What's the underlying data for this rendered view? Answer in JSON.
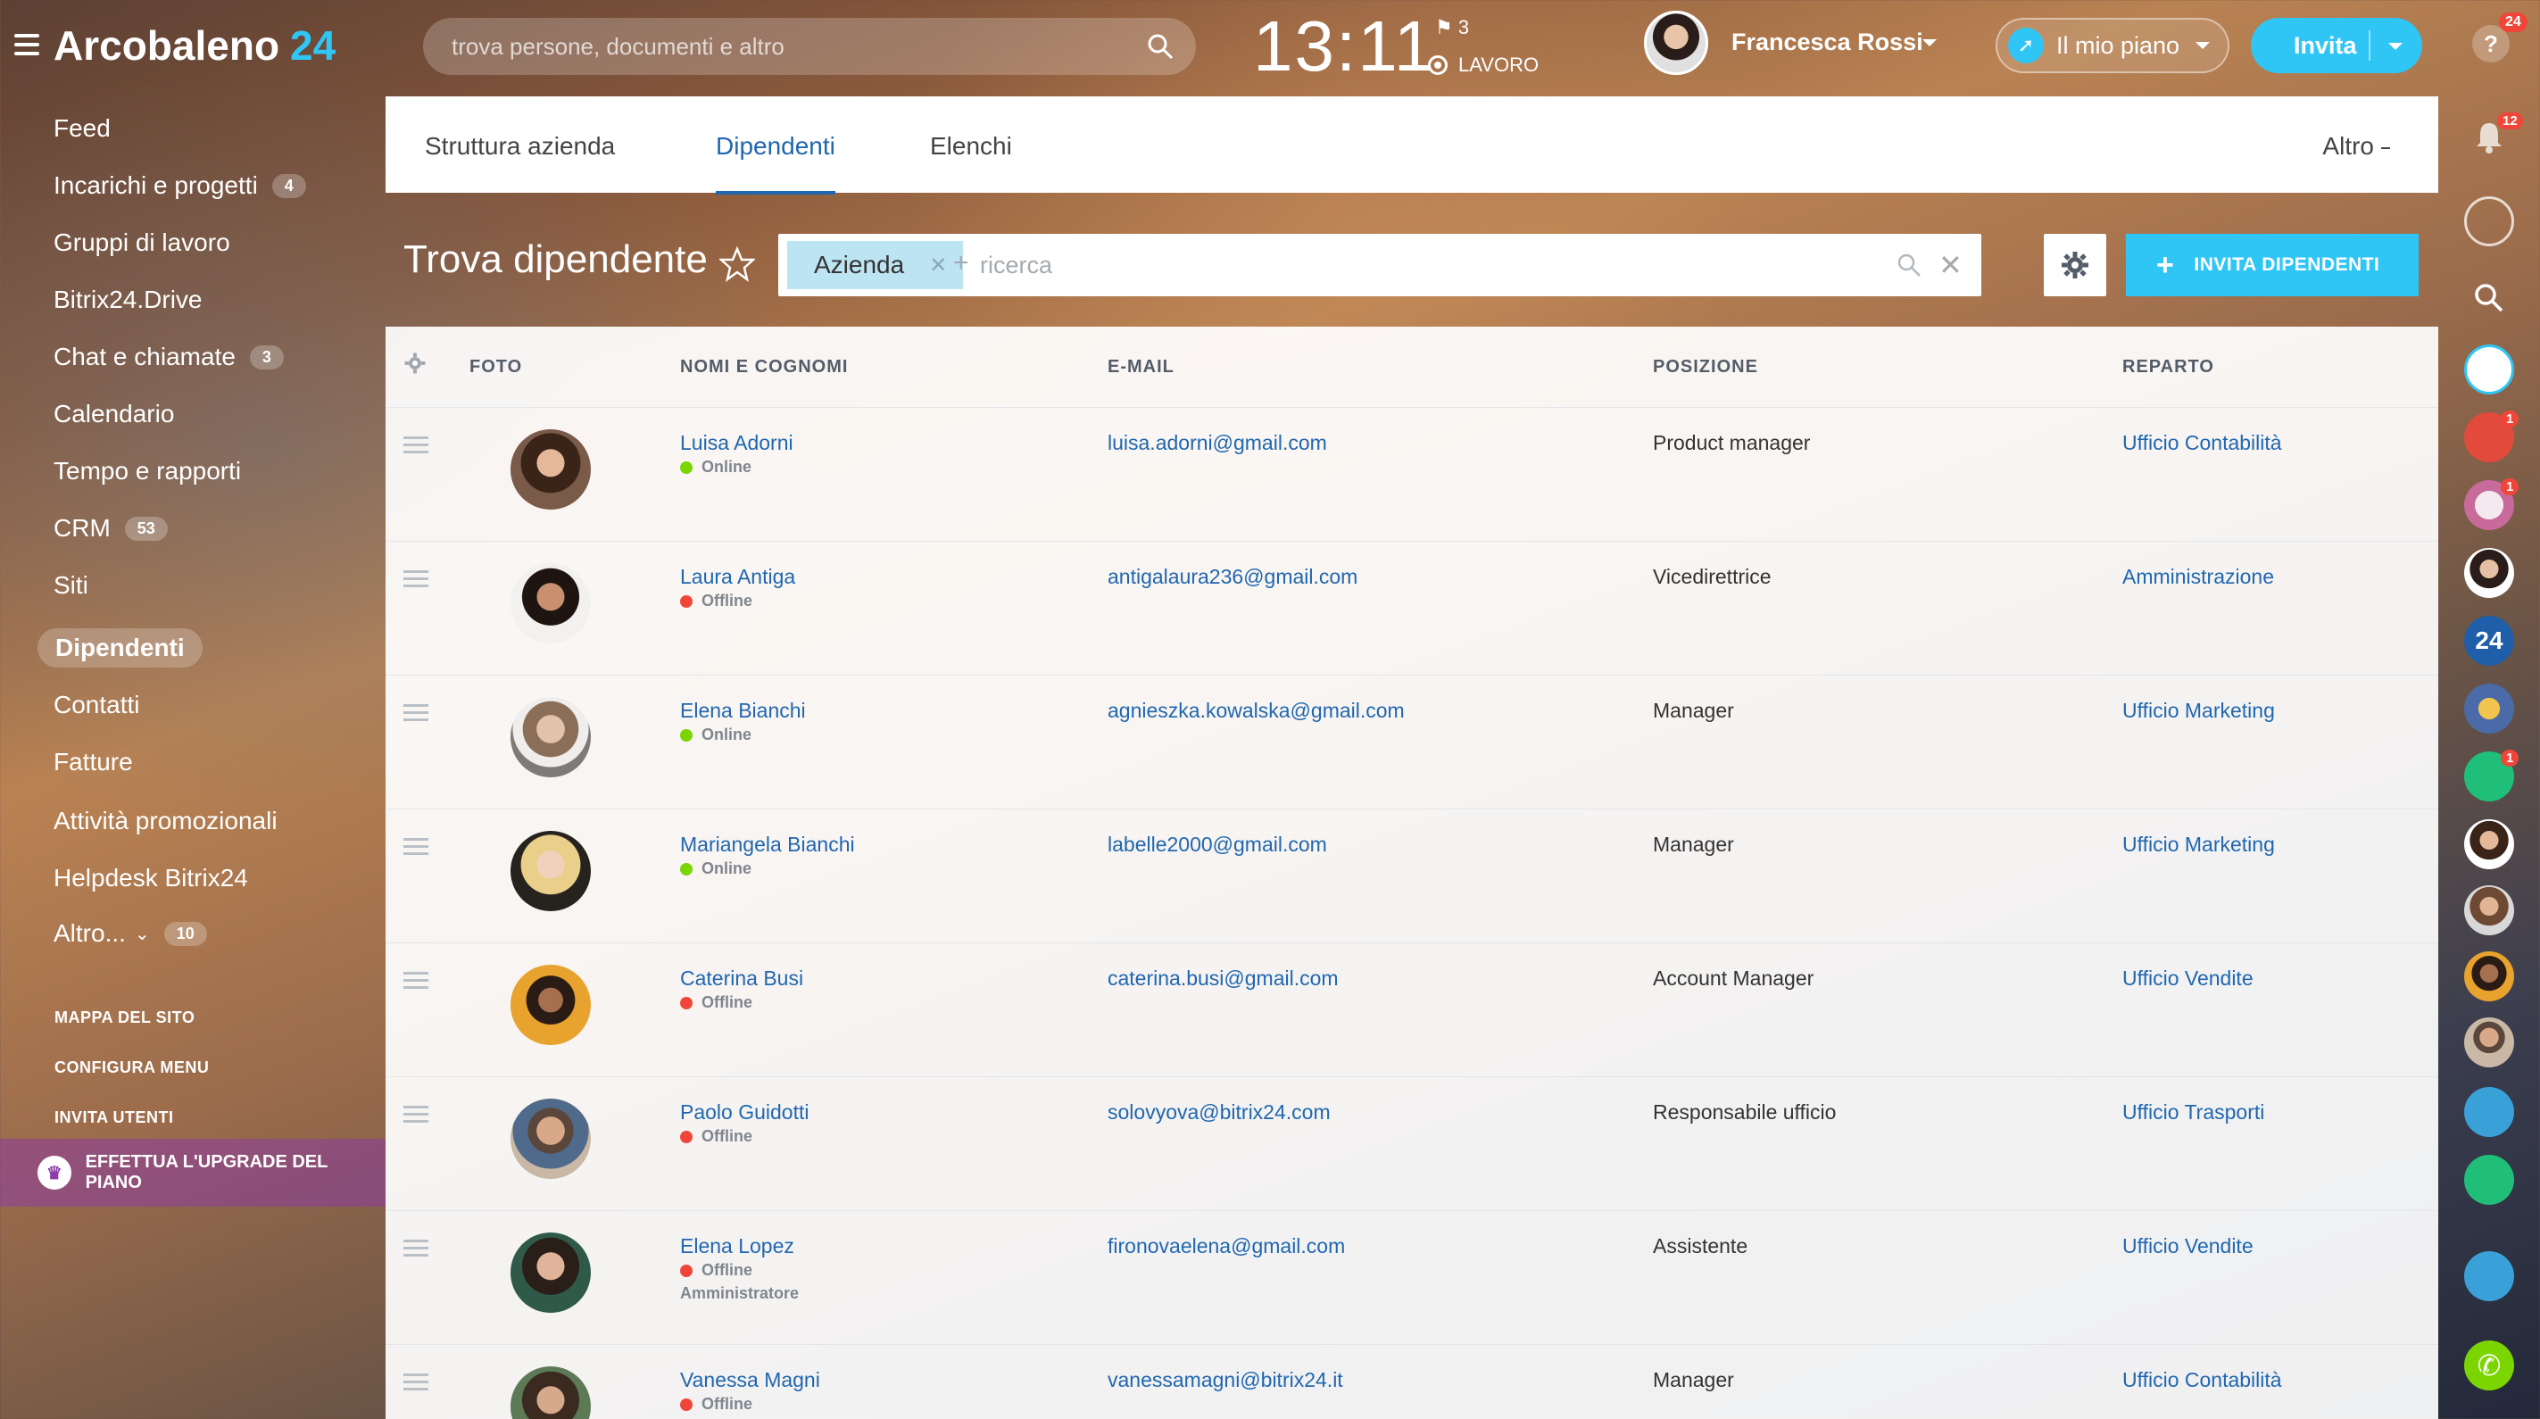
{
  "app": {
    "name": "Arcobaleno",
    "number": "24"
  },
  "search": {
    "placeholder": "trova persone, documenti e altro"
  },
  "clock": {
    "time": "13:11",
    "flag_count": "3",
    "status": "LAVORO"
  },
  "user": {
    "name": "Francesca Rossi"
  },
  "header": {
    "plan_label": "Il mio piano",
    "invite_label": "Invita",
    "help_label": "?",
    "help_badge": "24"
  },
  "sidebar": {
    "items": [
      {
        "label": "Feed"
      },
      {
        "label": "Incarichi e progetti",
        "count": "4"
      },
      {
        "label": "Gruppi di lavoro"
      },
      {
        "label": "Bitrix24.Drive"
      },
      {
        "label": "Chat e chiamate",
        "count": "3"
      },
      {
        "label": "Calendario"
      },
      {
        "label": "Tempo e rapporti"
      },
      {
        "label": "CRM",
        "count": "53"
      },
      {
        "label": "Siti"
      },
      {
        "label": "Dipendenti",
        "active": true
      },
      {
        "label": "Contatti"
      },
      {
        "label": "Fatture"
      },
      {
        "label": "Attività promozionali"
      },
      {
        "label": "Helpdesk Bitrix24"
      },
      {
        "label": "Altro...",
        "count": "10"
      }
    ],
    "links": [
      "MAPPA DEL SITO",
      "CONFIGURA MENU",
      "INVITA UTENTI"
    ],
    "upgrade_label": "EFFETTUA L'UPGRADE DEL PIANO"
  },
  "tabs": {
    "items": [
      "Struttura azienda",
      "Dipendenti",
      "Elenchi"
    ],
    "active": "Dipendenti",
    "more_label": "Altro"
  },
  "finder": {
    "title": "Trova dipendente",
    "chip_label": "Azienda",
    "search_placeholder": "ricerca",
    "invite_button": "INVITA DIPENDENTI"
  },
  "table": {
    "headers": {
      "photo": "FOTO",
      "name": "NOMI E COGNOMI",
      "email": "E-MAIL",
      "position": "POSIZIONE",
      "department": "REPARTO"
    },
    "rows": [
      {
        "name": "Luisa Adorni",
        "status": "Online",
        "email": "luisa.adorni@gmail.com",
        "position": "Product manager",
        "department": "Ufficio Contabilità"
      },
      {
        "name": "Laura Antiga",
        "status": "Offline",
        "email": "antigalaura236@gmail.com",
        "position": "Vicedirettrice",
        "department": "Amministrazione"
      },
      {
        "name": "Elena Bianchi",
        "status": "Online",
        "email": "agnieszka.kowalska@gmail.com",
        "position": "Manager",
        "department": "Ufficio Marketing"
      },
      {
        "name": "Mariangela Bianchi",
        "status": "Online",
        "email": "labelle2000@gmail.com",
        "position": "Manager",
        "department": "Ufficio Marketing"
      },
      {
        "name": "Caterina Busi",
        "status": "Offline",
        "email": "caterina.busi@gmail.com",
        "position": "Account Manager",
        "department": "Ufficio Vendite"
      },
      {
        "name": "Paolo Guidotti",
        "status": "Offline",
        "email": "solovyova@bitrix24.com",
        "position": "Responsabile ufficio",
        "department": "Ufficio Trasporti"
      },
      {
        "name": "Elena Lopez",
        "status": "Offline",
        "role": "Amministratore",
        "email": "fironovaelena@gmail.com",
        "position": "Assistente",
        "department": "Ufficio Vendite"
      },
      {
        "name": "Vanessa Magni",
        "status": "Offline",
        "email": "vanessamagni@bitrix24.it",
        "position": "Manager",
        "department": "Ufficio Contabilità"
      }
    ]
  },
  "rail": {
    "notifications_badge": "12",
    "badges": [
      "1",
      "1",
      "1"
    ],
    "calendar_label": "24"
  },
  "colors": {
    "accent": "#2fc6f6",
    "link": "#2067b0",
    "online": "#7bd500",
    "offline": "#f0463a"
  }
}
